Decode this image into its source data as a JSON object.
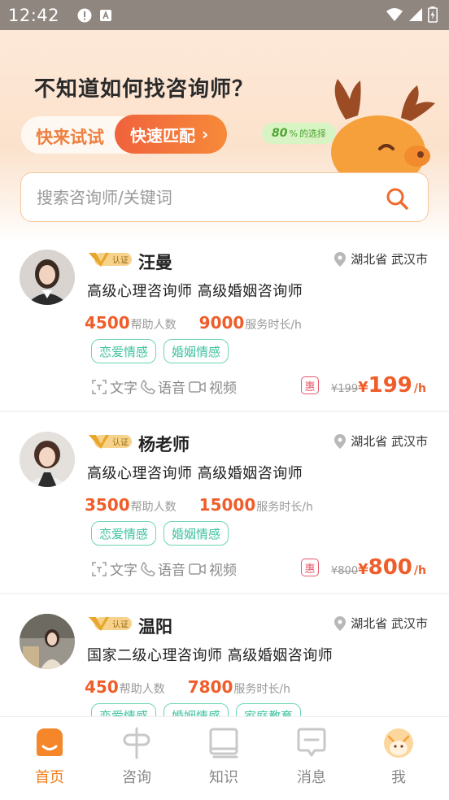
{
  "status_bar": {
    "time": "12:42"
  },
  "banner": {
    "title": "不知道如何找咨询师？",
    "try_label": "快来试试",
    "match_label": "快速匹配",
    "badge_percent": "80",
    "badge_unit": "%",
    "badge_text": "的选择"
  },
  "search": {
    "placeholder": "搜索咨询师/关键词"
  },
  "colors": {
    "accent": "#ef5e2a",
    "tab_active": "#f07d1a",
    "tag": "#3fc3a0"
  },
  "counselors": [
    {
      "name": "汪曼",
      "location": "湖北省 武汉市",
      "title": "高级心理咨询师 高级婚姻咨询师",
      "helped": "4500",
      "helped_label": "帮助人数",
      "hours": "9000",
      "hours_label": "服务时长/h",
      "tags": [
        "恋爱情感",
        "婚姻情感"
      ],
      "services": [
        "文字",
        "语音",
        "视频"
      ],
      "hui": "惠",
      "original_price": "¥199",
      "price_symbol": "¥",
      "price": "199",
      "unit": "/h",
      "verified": "认证"
    },
    {
      "name": "杨老师",
      "location": "湖北省 武汉市",
      "title": "高级心理咨询师 高级婚姻咨询师",
      "helped": "3500",
      "helped_label": "帮助人数",
      "hours": "15000",
      "hours_label": "服务时长/h",
      "tags": [
        "恋爱情感",
        "婚姻情感"
      ],
      "services": [
        "文字",
        "语音",
        "视频"
      ],
      "hui": "惠",
      "original_price": "¥800",
      "price_symbol": "¥",
      "price": "800",
      "unit": "/h",
      "verified": "认证"
    },
    {
      "name": "温阳",
      "location": "湖北省 武汉市",
      "title": "国家二级心理咨询师 高级婚姻咨询师",
      "helped": "450",
      "helped_label": "帮助人数",
      "hours": "7800",
      "hours_label": "服务时长/h",
      "tags": [
        "恋爱情感",
        "婚姻情感",
        "家庭教育"
      ],
      "verified": "认证"
    }
  ],
  "tabbar": [
    {
      "label": "首页",
      "icon": "home-icon",
      "active": true
    },
    {
      "label": "咨询",
      "icon": "consult-icon",
      "active": false
    },
    {
      "label": "知识",
      "icon": "knowledge-icon",
      "active": false
    },
    {
      "label": "消息",
      "icon": "message-icon",
      "active": false
    },
    {
      "label": "我",
      "icon": "profile-icon",
      "active": false
    }
  ]
}
